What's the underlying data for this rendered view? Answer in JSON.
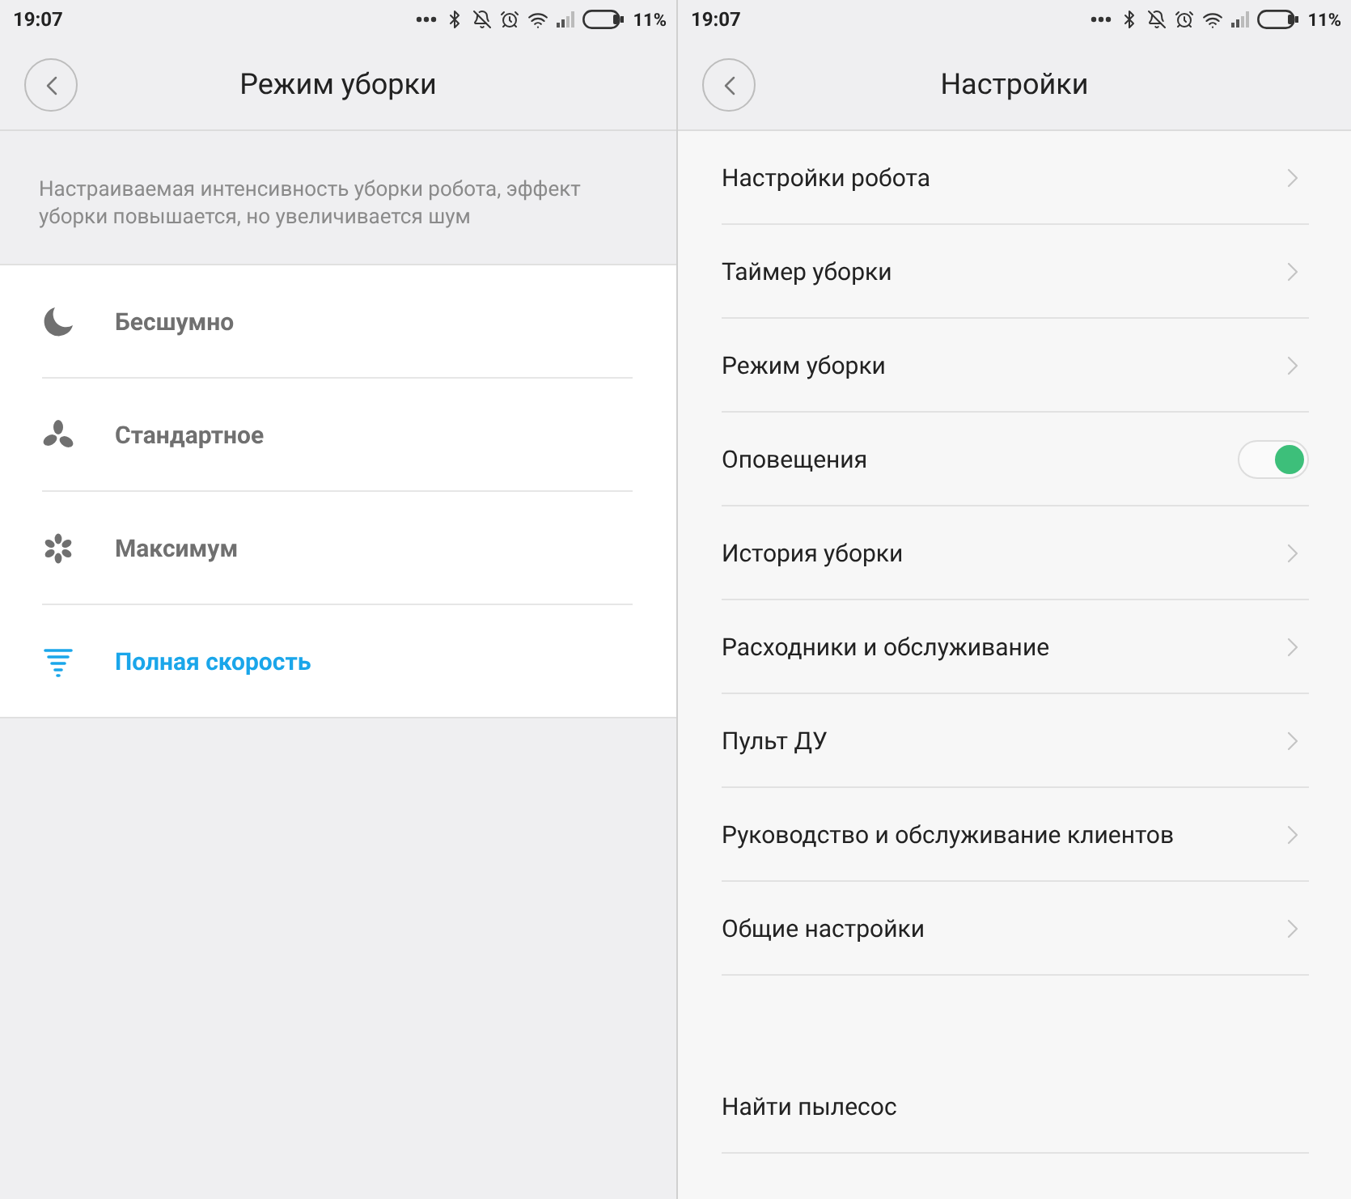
{
  "left_screen": {
    "status_bar": {
      "time": "19:07",
      "battery": "11%"
    },
    "title": "Режим уборки",
    "description": "Настраиваемая интенсивность уборки робота, эффект уборки повышается, но увеличивается шум",
    "modes": [
      {
        "label": "Бесшумно",
        "kind": "moon",
        "selected": false
      },
      {
        "label": "Стандартное",
        "kind": "fan3",
        "selected": false
      },
      {
        "label": "Максимум",
        "kind": "fan6",
        "selected": false
      },
      {
        "label": "Полная скорость",
        "kind": "tornado",
        "selected": true
      }
    ]
  },
  "right_screen": {
    "status_bar": {
      "time": "19:07",
      "battery": "11%"
    },
    "title": "Настройки",
    "items": [
      {
        "kind": "link",
        "label": "Настройки робота"
      },
      {
        "kind": "link",
        "label": "Таймер уборки"
      },
      {
        "kind": "link",
        "label": "Режим уборки"
      },
      {
        "kind": "toggle",
        "label": "Оповещения",
        "on": true
      },
      {
        "kind": "link",
        "label": "История уборки"
      },
      {
        "kind": "link",
        "label": "Расходники и обслуживание"
      },
      {
        "kind": "link",
        "label": "Пульт ДУ"
      },
      {
        "kind": "link",
        "label": "Руководство и обслуживание клиентов"
      },
      {
        "kind": "link",
        "label": "Общие настройки"
      }
    ],
    "footer_items": [
      {
        "label": "Найти пылесос"
      }
    ]
  }
}
